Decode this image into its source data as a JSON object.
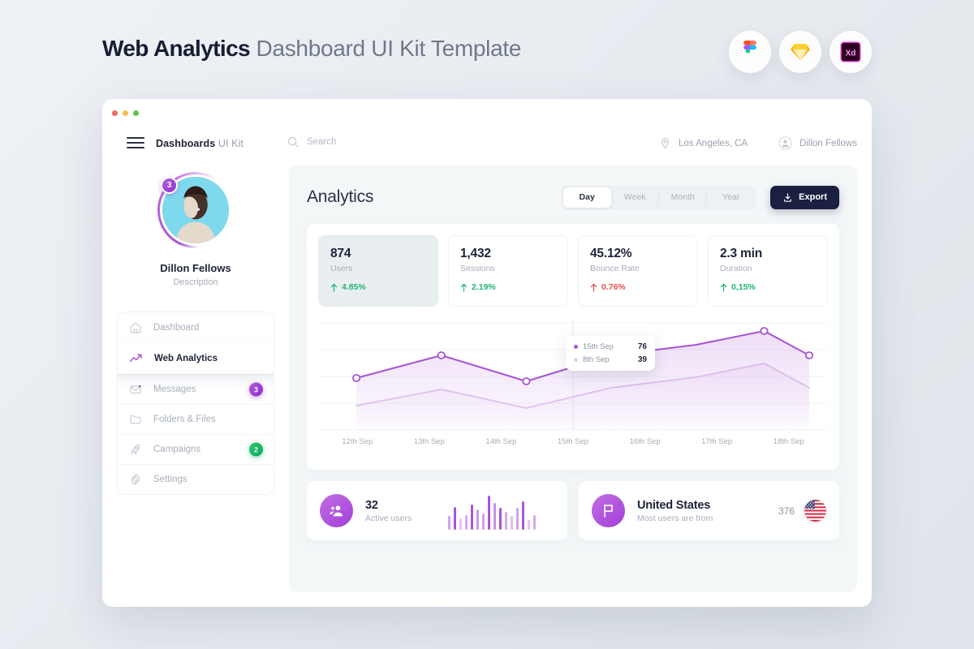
{
  "promo": {
    "title_strong": "Web Analytics",
    "title_rest": " Dashboard UI Kit Template",
    "badges": [
      {
        "name": "figma-icon",
        "label": "Figma"
      },
      {
        "name": "sketch-icon",
        "label": "Sketch"
      },
      {
        "name": "adobe-xd-icon",
        "label": "Xd"
      }
    ]
  },
  "topbar": {
    "menu_icon": "hamburger-icon",
    "brand_strong": "Dashboards",
    "brand_rest": " UI Kit",
    "search": {
      "icon": "search-icon",
      "placeholder": "Search",
      "value": ""
    },
    "location": {
      "icon": "location-pin-icon",
      "label": "Los Angeles, CA"
    },
    "account": {
      "icon": "user-circle-icon",
      "label": "Dillon Fellows"
    }
  },
  "sidebar": {
    "profile": {
      "badge": "3",
      "name": "Dillon Fellows",
      "description": "Description"
    },
    "items": [
      {
        "label": "Dashboard",
        "icon": "home-icon",
        "active": false,
        "badge": null,
        "badge_color": null
      },
      {
        "label": "Web Analytics",
        "icon": "trending-up-icon",
        "active": true,
        "badge": null,
        "badge_color": null
      },
      {
        "label": "Messages",
        "icon": "envelope-icon",
        "active": false,
        "badge": "3",
        "badge_color": "purple"
      },
      {
        "label": "Folders & Files",
        "icon": "folder-icon",
        "active": false,
        "badge": null,
        "badge_color": null
      },
      {
        "label": "Campaigns",
        "icon": "rocket-icon",
        "active": false,
        "badge": "2",
        "badge_color": "green"
      },
      {
        "label": "Settings",
        "icon": "gear-icon",
        "active": false,
        "badge": null,
        "badge_color": null
      }
    ]
  },
  "main": {
    "title": "Analytics",
    "range_tabs": [
      {
        "label": "Day",
        "active": true
      },
      {
        "label": "Week",
        "active": false
      },
      {
        "label": "Month",
        "active": false
      },
      {
        "label": "Year",
        "active": false
      }
    ],
    "export": {
      "label": "Export",
      "icon": "download-icon"
    },
    "kpis": [
      {
        "value": "874",
        "label": "Users",
        "delta": "4.85%",
        "direction": "up",
        "active": true
      },
      {
        "value": "1,432",
        "label": "Sessions",
        "delta": "2.19%",
        "direction": "up",
        "active": false
      },
      {
        "value": "45.12%",
        "label": "Bounce Rate",
        "delta": "0.76%",
        "direction": "down",
        "active": false
      },
      {
        "value": "2.3 min",
        "label": "Duration",
        "delta": "0,15%",
        "direction": "up",
        "active": false
      }
    ],
    "tooltip": {
      "rows": [
        {
          "label": "15th Sep",
          "value": "76",
          "color": "#a855d6"
        },
        {
          "label": "8th Sep",
          "value": "39",
          "color": "#e4cdf2"
        }
      ]
    },
    "bottom_cards": [
      {
        "icon": "users-group-icon",
        "value": "32",
        "subtitle": "Active users",
        "type": "sparkline"
      },
      {
        "icon": "flag-icon",
        "value": "United States",
        "subtitle": "Most users are from",
        "type": "country",
        "count": "376",
        "flag": "us-flag-icon"
      }
    ]
  },
  "colors": {
    "accent_purple": "#a855d6",
    "accent_purple_light": "#e4cdf2",
    "positive_green": "#21b573",
    "negative_red": "#e8504d",
    "dark_navy": "#1b2042",
    "panel_bg": "#f3f7f8"
  },
  "chart_data": {
    "type": "area",
    "title": "Analytics",
    "xlabel": "",
    "ylabel": "",
    "grid": true,
    "legend_position": "tooltip",
    "categories": [
      "12th Sep",
      "13th Sep",
      "14th Sep",
      "15th Sep",
      "16th Sep",
      "17th Sep",
      "18th Sep"
    ],
    "ylim": [
      0,
      100
    ],
    "series": [
      {
        "name": "15th Sep",
        "color": "#a855d6",
        "markers": true,
        "values": [
          55,
          75,
          51,
          76,
          86,
          100,
          75
        ]
      },
      {
        "name": "8th Sep",
        "color": "#e4cdf2",
        "markers": false,
        "values": [
          21,
          25,
          13,
          39,
          50,
          48,
          62
        ]
      }
    ],
    "highlight_index": 3,
    "highlight_values": {
      "15th Sep": 76,
      "8th Sep": 39
    }
  },
  "sparkline": {
    "type": "bar",
    "values": [
      36,
      62,
      30,
      40,
      68,
      55,
      44,
      92,
      72,
      60,
      48,
      36,
      58,
      76,
      26,
      40
    ],
    "opacities": [
      0.55,
      1,
      0.35,
      0.5,
      1,
      0.6,
      0.55,
      1,
      0.65,
      1,
      0.5,
      0.4,
      0.55,
      1,
      0.35,
      0.5
    ]
  }
}
